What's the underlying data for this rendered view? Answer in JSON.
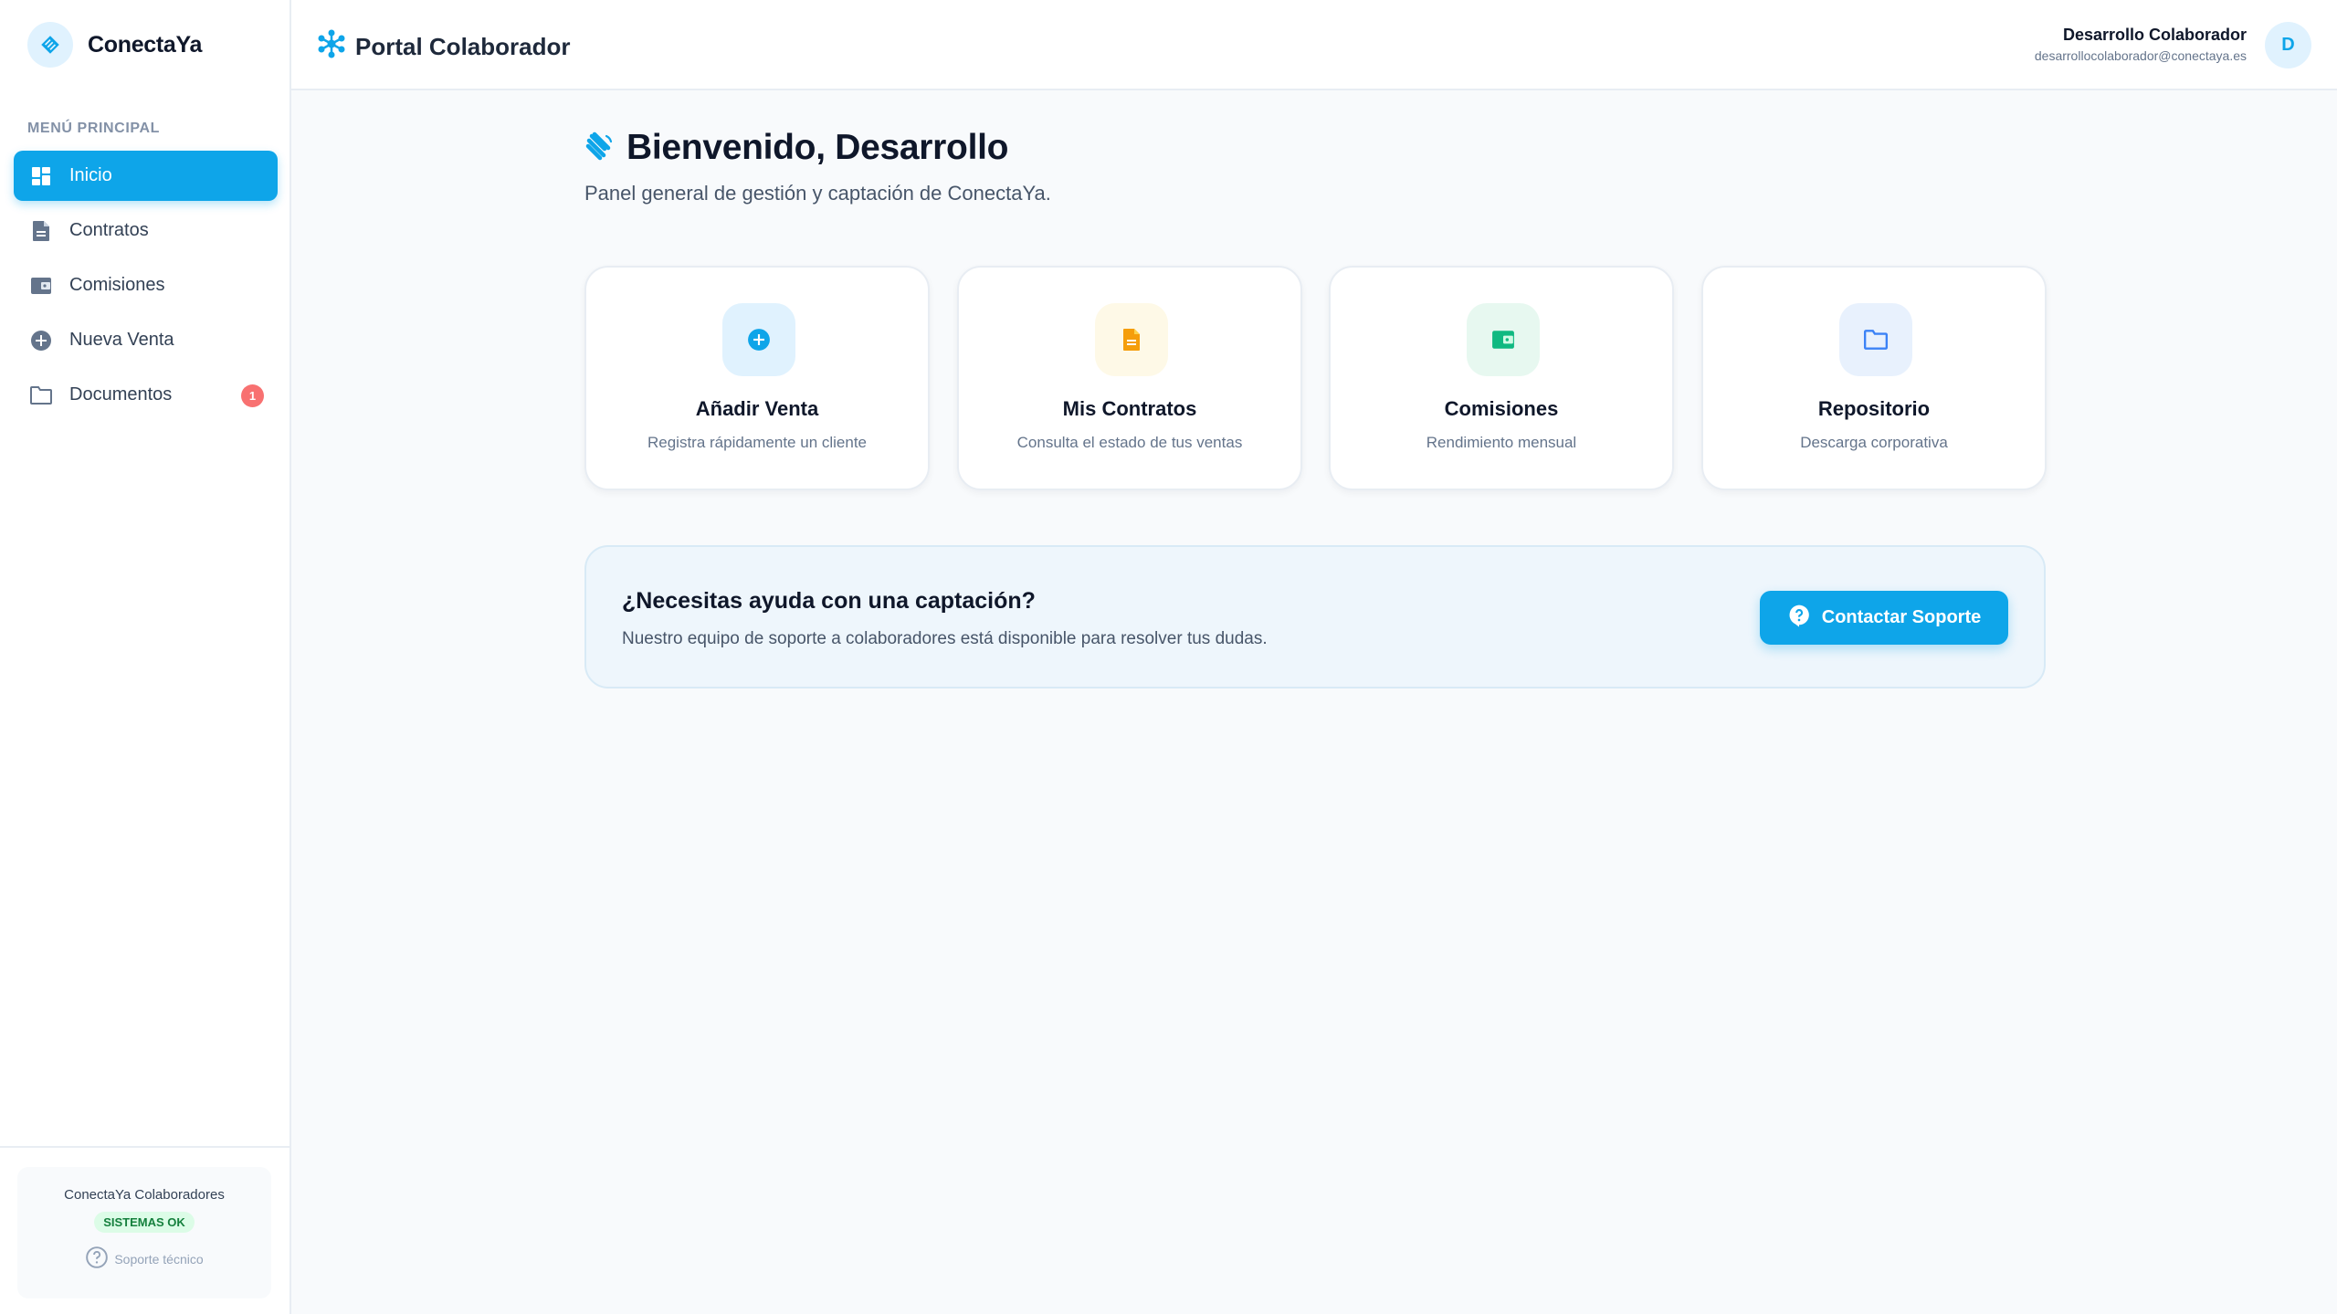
{
  "brand": {
    "name": "ConectaYa"
  },
  "sidebar": {
    "heading": "MENÚ PRINCIPAL",
    "items": [
      {
        "label": "Inicio",
        "icon": "dashboard-icon",
        "active": true
      },
      {
        "label": "Contratos",
        "icon": "document-icon"
      },
      {
        "label": "Comisiones",
        "icon": "wallet-icon"
      },
      {
        "label": "Nueva Venta",
        "icon": "plus-circle-icon"
      },
      {
        "label": "Documentos",
        "icon": "folder-icon",
        "badge": "1"
      }
    ],
    "footer": {
      "title": "ConectaYa Colaboradores",
      "status": "SISTEMAS OK",
      "support": "Soporte técnico"
    }
  },
  "header": {
    "title": "Portal Colaborador",
    "user_name": "Desarrollo Colaborador",
    "user_email": "desarrollocolaborador@conectaya.es",
    "avatar_initial": "D"
  },
  "main": {
    "welcome_title": "Bienvenido, Desarrollo",
    "welcome_subtitle": "Panel general de gestión y captación de ConectaYa.",
    "cards": [
      {
        "title": "Añadir Venta",
        "desc": "Registra rápidamente un cliente",
        "icon": "plus-circle-icon",
        "color": "#0ea5e9",
        "bg": "#e0f2fe"
      },
      {
        "title": "Mis Contratos",
        "desc": "Consulta el estado de tus ventas",
        "icon": "document-icon",
        "color": "#f59e0b",
        "bg": "#fef9e7"
      },
      {
        "title": "Comisiones",
        "desc": "Rendimiento mensual",
        "icon": "wallet-icon",
        "color": "#10b981",
        "bg": "#e7f8f0"
      },
      {
        "title": "Repositorio",
        "desc": "Descarga corporativa",
        "icon": "folder-icon",
        "color": "#3b82f6",
        "bg": "#e8f1fd"
      }
    ],
    "help": {
      "title": "¿Necesitas ayuda con una captación?",
      "text": "Nuestro equipo de soporte a colaboradores está disponible para resolver tus dudas.",
      "button": "Contactar Soporte"
    }
  },
  "colors": {
    "accent": "#0ea5e9",
    "badge": "#f87171",
    "status_ok": "#15803d"
  }
}
